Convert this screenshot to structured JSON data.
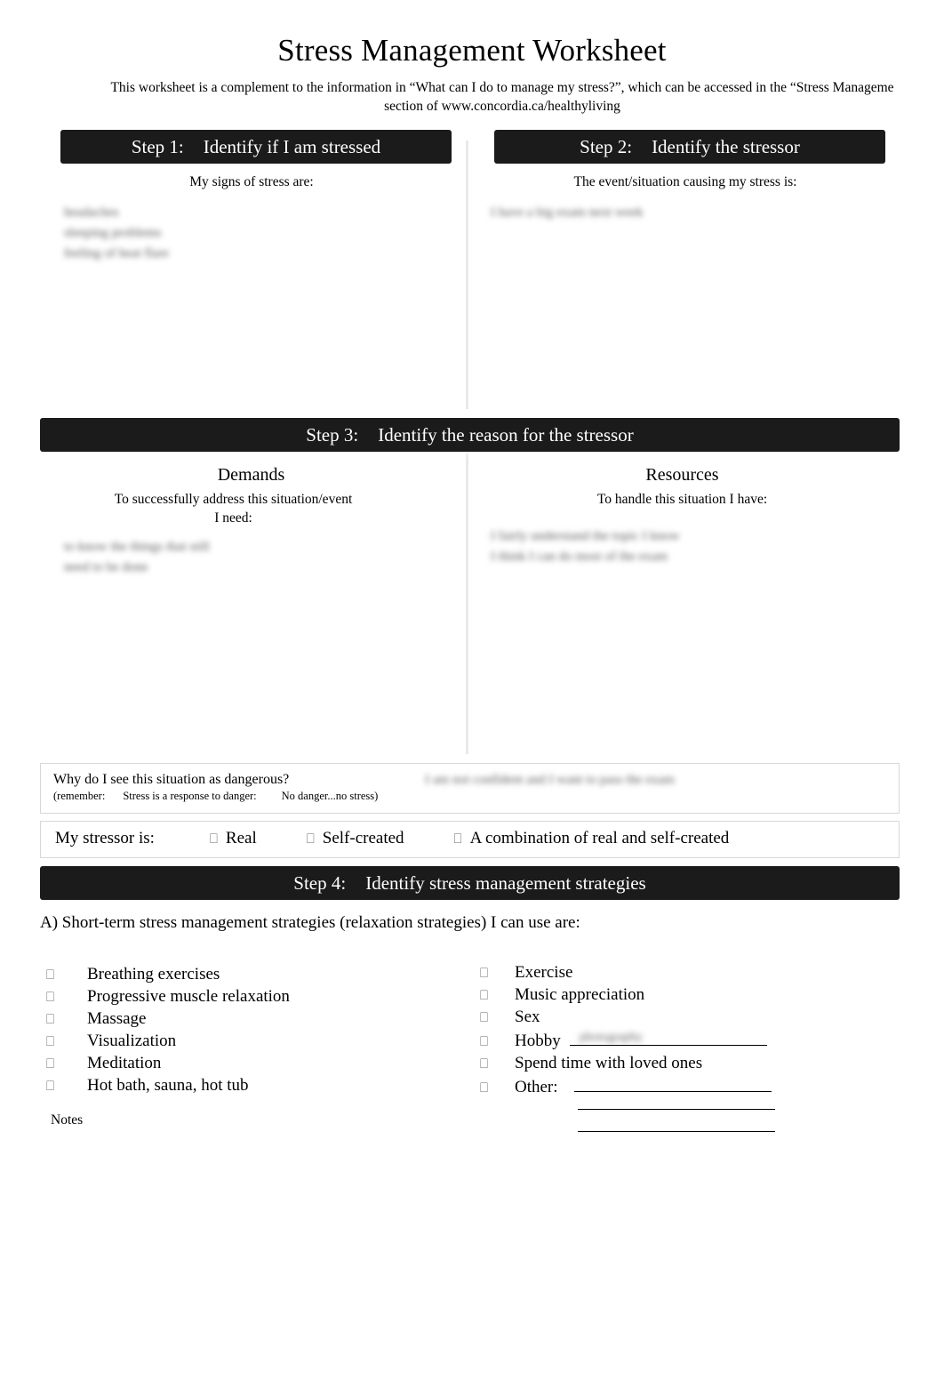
{
  "document": {
    "title": "Stress Management Worksheet",
    "subtitle_line1": "This worksheet is a complement to the information in “What can I do to manage my stress?”, which can be accessed in the “Stress Manageme",
    "subtitle_line2": "section of www.concordia.ca/healthyliving"
  },
  "step1": {
    "number": "Step 1:",
    "heading": "Identify if I am stressed",
    "prompt": "My signs of stress are:",
    "answer_redacted": "headaches\nsleeping problems\nfeeling of heat flare"
  },
  "step2": {
    "number": "Step 2:",
    "heading": "Identify the stressor",
    "prompt": "The event/situation causing my stress is:",
    "answer_redacted": "I have a big exam next week"
  },
  "step3": {
    "number": "Step 3:",
    "heading": "Identify the reason for the stressor",
    "demands": {
      "title": "Demands",
      "prompt_line1": "To successfully address this situation/event",
      "prompt_line2": "I need:",
      "answer_redacted": "to know the things that still\nneed to be done"
    },
    "resources": {
      "title": "Resources",
      "prompt": "To handle this situation I have:",
      "answer_redacted": "I fairly understand the topic I know\nI think I can do most of the exam"
    }
  },
  "danger": {
    "question": "Why do I see this situation as dangerous?",
    "remember_prefix": "(remember:",
    "remember_mid": "Stress is a response to danger:",
    "remember_suffix": "No danger...no stress)",
    "answer_redacted": "I am not confident and I want to pass the exam"
  },
  "stressor": {
    "label": "My stressor is:",
    "options": [
      {
        "checkbox": "checkbox-icon",
        "label": "Real"
      },
      {
        "checkbox": "checkbox-icon",
        "label": "Self-created"
      },
      {
        "checkbox": "checkbox-icon",
        "label": "A combination of real and self-created"
      }
    ]
  },
  "step4": {
    "number": "Step 4:",
    "heading": "Identify stress management strategies",
    "intro": "A) Short-term stress management strategies (relaxation strategies) I can use are:",
    "left_options": [
      {
        "checkbox": "checkbox-icon",
        "label": "Breathing exercises"
      },
      {
        "checkbox": "checkbox-icon",
        "label": "Progressive muscle relaxation"
      },
      {
        "checkbox": "checkbox-icon",
        "label": "Massage"
      },
      {
        "checkbox": "checkbox-icon",
        "label": "Visualization"
      },
      {
        "checkbox": "checkbox-icon",
        "label": "Meditation"
      },
      {
        "checkbox": "checkbox-icon",
        "label": "Hot bath, sauna, hot tub"
      }
    ],
    "right_options": [
      {
        "checkbox": "checkbox-icon",
        "label": "Exercise",
        "rule": false
      },
      {
        "checkbox": "checkbox-icon",
        "label": "Music appreciation",
        "rule": false
      },
      {
        "checkbox": "checkbox-icon",
        "label": "Sex",
        "rule": false
      },
      {
        "checkbox": "checkbox-icon",
        "label": "Hobby",
        "rule": true
      },
      {
        "checkbox": "checkbox-icon",
        "label": "Spend time with loved ones",
        "rule": false
      },
      {
        "checkbox": "checkbox-icon",
        "label": "Other:",
        "rule": true
      }
    ],
    "hobby_value_redacted": "photography",
    "notes_label": "Notes"
  },
  "glyphs": {
    "checkbox": "⎕"
  },
  "colors": {
    "banner_bg": "#1b1b1b",
    "banner_text": "#ffffff",
    "page_bg": "#ffffff",
    "rule": "#000000",
    "box_border": "#d8d8d8",
    "redacted_ink": "#5a5a5a"
  }
}
